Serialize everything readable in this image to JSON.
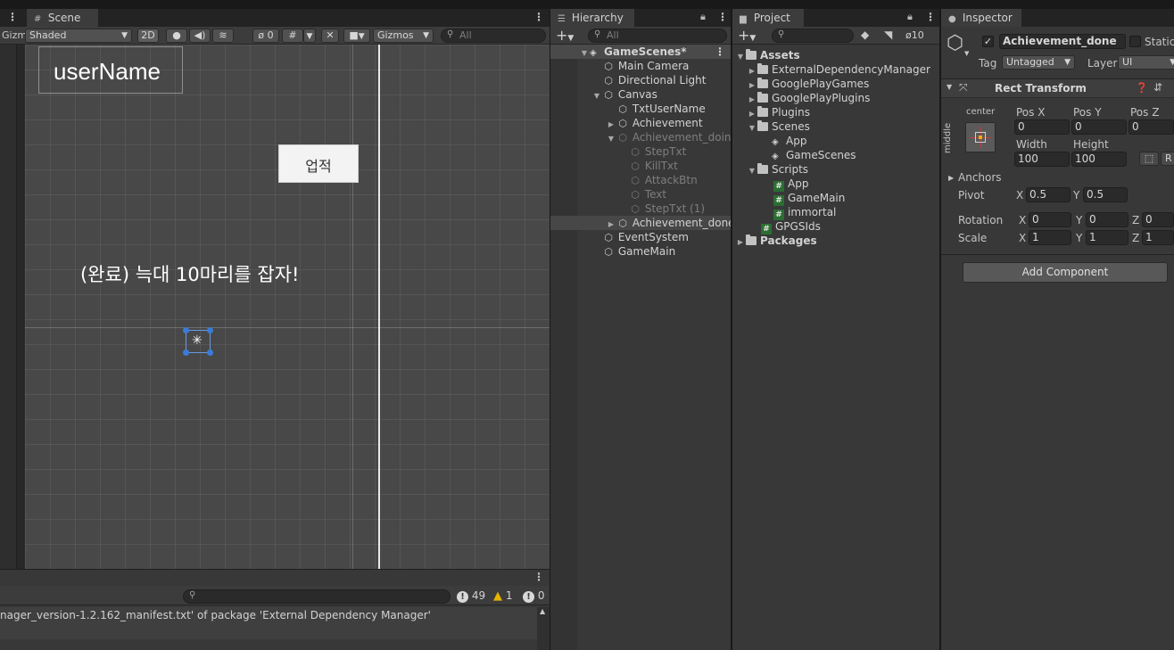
{
  "scene_tab": {
    "title": "Scene",
    "left_stub": "Gizm",
    "shading_mode": "Shaded",
    "mode_2d": "2D",
    "hidden_count": "0",
    "gizmos_label": "Gizmos",
    "search_placeholder": "All"
  },
  "scene_view": {
    "username_text": "userName",
    "button_text": "업적",
    "completion_text": "(완료) 늑대 10마리를 잡자!"
  },
  "console": {
    "message": "nager_version-1.2.162_manifest.txt' of package 'External Dependency Manager'",
    "error_count": "49",
    "warning_count": "1",
    "info_count": "0"
  },
  "hierarchy": {
    "title": "Hierarchy",
    "search_placeholder": "All",
    "root": "GameScenes*",
    "items": [
      {
        "label": "Main Camera"
      },
      {
        "label": "Directional Light"
      },
      {
        "label": "Canvas"
      },
      {
        "label": "TxtUserName"
      },
      {
        "label": "Achievement"
      },
      {
        "label": "Achievement_doing"
      },
      {
        "label": "StepTxt"
      },
      {
        "label": "KillTxt"
      },
      {
        "label": "AttackBtn"
      },
      {
        "label": "Text"
      },
      {
        "label": "StepTxt (1)"
      },
      {
        "label": "Achievement_done"
      },
      {
        "label": "EventSystem"
      },
      {
        "label": "GameMain"
      }
    ]
  },
  "project": {
    "title": "Project",
    "hidden_count": "10",
    "items": [
      {
        "label": "Assets"
      },
      {
        "label": "ExternalDependencyManager"
      },
      {
        "label": "GooglePlayGames"
      },
      {
        "label": "GooglePlayPlugins"
      },
      {
        "label": "Plugins"
      },
      {
        "label": "Scenes"
      },
      {
        "label": "App"
      },
      {
        "label": "GameScenes"
      },
      {
        "label": "Scripts"
      },
      {
        "label": "App"
      },
      {
        "label": "GameMain"
      },
      {
        "label": "immortal"
      },
      {
        "label": "GPGSIds"
      },
      {
        "label": "Packages"
      }
    ]
  },
  "inspector": {
    "title": "Inspector",
    "object_name": "Achievement_done",
    "static_label": "Static",
    "tag_label": "Tag",
    "tag_value": "Untagged",
    "layer_label": "Layer",
    "layer_value": "UI",
    "rect_transform_title": "Rect Transform",
    "anchor_h": "center",
    "anchor_v": "middle",
    "pos_x_label": "Pos X",
    "pos_y_label": "Pos Y",
    "pos_z_label": "Pos Z",
    "pos_x": "0",
    "pos_y": "0",
    "pos_z": "0",
    "width_label": "Width",
    "height_label": "Height",
    "width": "100",
    "height": "100",
    "r_button": "R",
    "anchors_label": "Anchors",
    "pivot_label": "Pivot",
    "pivot_x": "0.5",
    "pivot_y": "0.5",
    "rotation_label": "Rotation",
    "rotation_x": "0",
    "rotation_y": "0",
    "rotation_z": "0",
    "scale_label": "Scale",
    "scale_x": "1",
    "scale_y": "1",
    "scale_z": "1",
    "axis_x": "X",
    "axis_y": "Y",
    "axis_z": "Z",
    "add_component": "Add Component"
  },
  "colors": {
    "accent_selected": "#474747",
    "hash_script": "#2b6e32",
    "warning": "#e6b400"
  }
}
